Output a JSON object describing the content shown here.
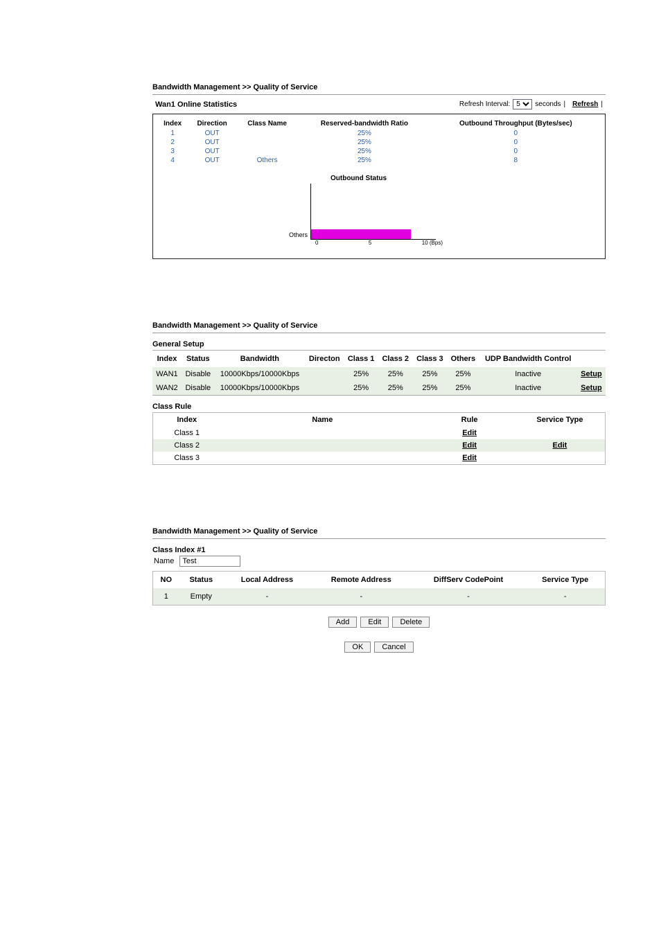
{
  "panel1": {
    "breadcrumb": "Bandwidth Management >> Quality of Service",
    "stats_title": "Wan1 Online Statistics",
    "refresh_label": "Refresh Interval:",
    "refresh_value": "5",
    "refresh_unit": "seconds",
    "refresh_link": "Refresh",
    "headers": {
      "index": "Index",
      "direction": "Direction",
      "class_name": "Class Name",
      "ratio": "Reserved-bandwidth Ratio",
      "throughput": "Outbound Throughput (Bytes/sec)"
    },
    "rows": [
      {
        "index": "1",
        "direction": "OUT",
        "class_name": "",
        "ratio": "25%",
        "throughput": "0"
      },
      {
        "index": "2",
        "direction": "OUT",
        "class_name": "",
        "ratio": "25%",
        "throughput": "0"
      },
      {
        "index": "3",
        "direction": "OUT",
        "class_name": "",
        "ratio": "25%",
        "throughput": "0"
      },
      {
        "index": "4",
        "direction": "OUT",
        "class_name": "Others",
        "ratio": "25%",
        "throughput": "8"
      }
    ],
    "chart": {
      "title": "Outbound Status",
      "ylabel": "Others",
      "x0": "0",
      "x1": "5",
      "x2": "10 (Bps)"
    }
  },
  "panel2": {
    "breadcrumb": "Bandwidth Management >> Quality of Service",
    "general_setup": "General Setup",
    "gs_headers": {
      "index": "Index",
      "status": "Status",
      "bandwidth": "Bandwidth",
      "direction": "Directon",
      "c1": "Class 1",
      "c2": "Class 2",
      "c3": "Class 3",
      "others": "Others",
      "udp": "UDP Bandwidth Control",
      "setup": ""
    },
    "gs_rows": [
      {
        "index": "WAN1",
        "status": "Disable",
        "bandwidth": "10000Kbps/10000Kbps",
        "direction": "",
        "c1": "25%",
        "c2": "25%",
        "c3": "25%",
        "others": "25%",
        "udp": "Inactive",
        "setup": "Setup"
      },
      {
        "index": "WAN2",
        "status": "Disable",
        "bandwidth": "10000Kbps/10000Kbps",
        "direction": "",
        "c1": "25%",
        "c2": "25%",
        "c3": "25%",
        "others": "25%",
        "udp": "Inactive",
        "setup": "Setup"
      }
    ],
    "class_rule": "Class Rule",
    "cr_headers": {
      "index": "Index",
      "name": "Name",
      "rule": "Rule",
      "stype": "Service Type"
    },
    "cr_rows": [
      {
        "index": "Class 1",
        "name": "",
        "rule": "Edit",
        "stype": ""
      },
      {
        "index": "Class 2",
        "name": "",
        "rule": "Edit",
        "stype": "Edit"
      },
      {
        "index": "Class 3",
        "name": "",
        "rule": "Edit",
        "stype": ""
      }
    ]
  },
  "panel3": {
    "breadcrumb": "Bandwidth Management >> Quality of Service",
    "class_index": "Class Index #1",
    "name_label": "Name",
    "name_value": "Test",
    "ci_headers": {
      "no": "NO",
      "status": "Status",
      "local": "Local Address",
      "remote": "Remote Address",
      "diffserv": "DiffServ CodePoint",
      "stype": "Service Type"
    },
    "ci_rows": [
      {
        "no": "1",
        "status": "Empty",
        "local": "-",
        "remote": "-",
        "diffserv": "-",
        "stype": "-"
      }
    ],
    "buttons": {
      "add": "Add",
      "edit": "Edit",
      "delete": "Delete",
      "ok": "OK",
      "cancel": "Cancel"
    }
  },
  "chart_data": {
    "type": "bar",
    "orientation": "horizontal",
    "title": "Outbound Status",
    "categories": [
      "Others"
    ],
    "values": [
      8
    ],
    "xlabel": "(Bps)",
    "ylabel": "",
    "xlim": [
      0,
      10
    ]
  }
}
